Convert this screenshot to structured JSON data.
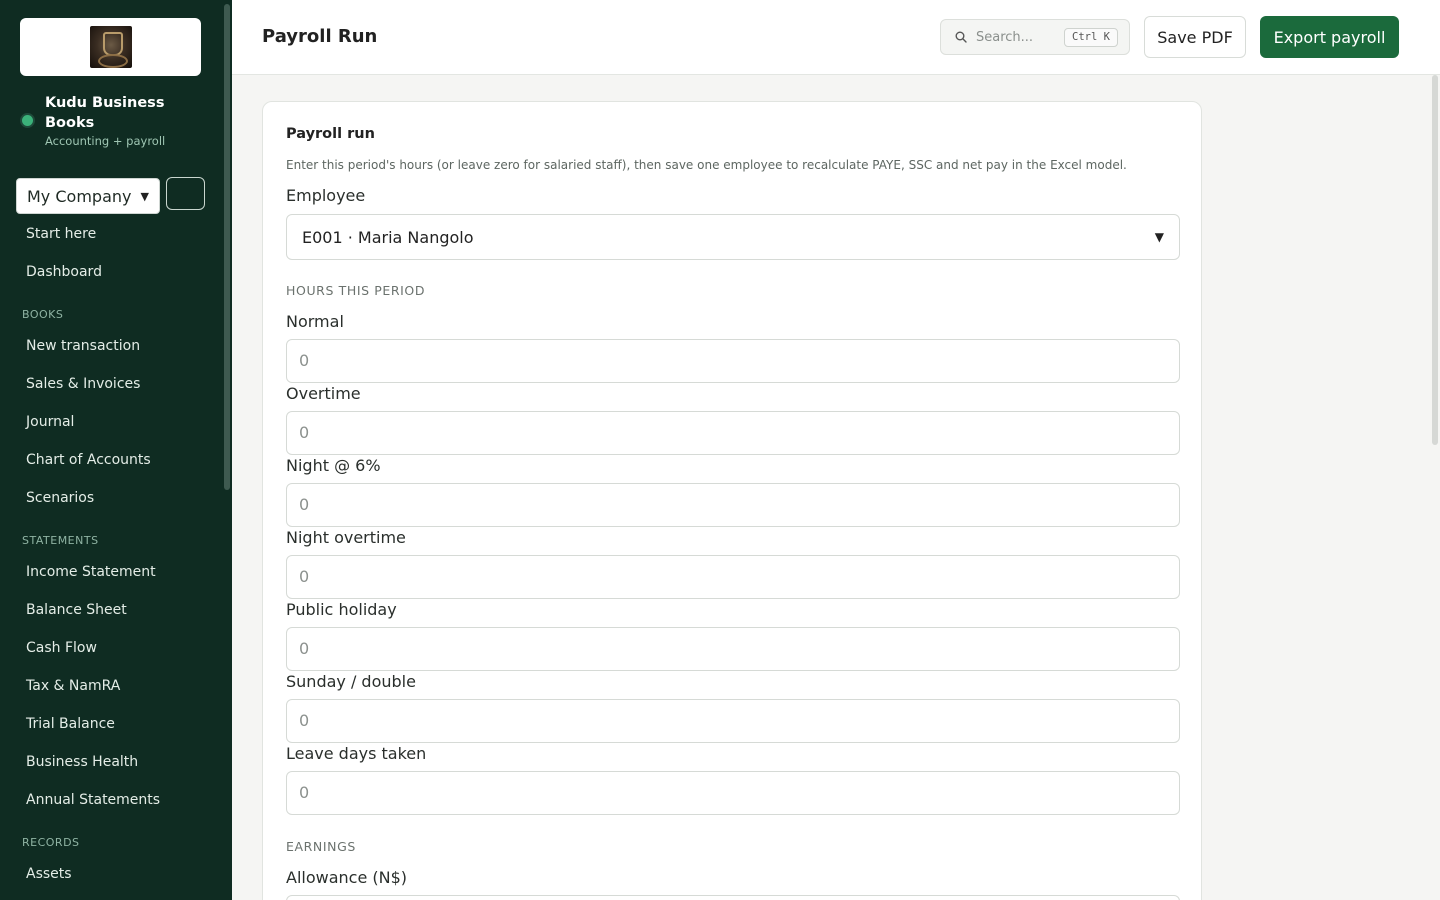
{
  "sidebar": {
    "brand_name": "Kudu Business Books",
    "brand_subtitle": "Accounting + payroll",
    "company_select": "My Company",
    "top_items": [
      "Start here",
      "Dashboard"
    ],
    "sections": [
      {
        "title": "BOOKS",
        "items": [
          "New transaction",
          "Sales & Invoices",
          "Journal",
          "Chart of Accounts",
          "Scenarios"
        ]
      },
      {
        "title": "STATEMENTS",
        "items": [
          "Income Statement",
          "Balance Sheet",
          "Cash Flow",
          "Tax & NamRA",
          "Trial Balance",
          "Business Health",
          "Annual Statements"
        ]
      },
      {
        "title": "RECORDS",
        "items": [
          "Assets"
        ]
      }
    ]
  },
  "header": {
    "title": "Payroll Run",
    "search_placeholder": "Search...",
    "search_shortcut": "Ctrl K",
    "save_pdf": "Save PDF",
    "export": "Export payroll"
  },
  "card": {
    "title": "Payroll run",
    "description": "Enter this period's hours (or leave zero for salaried staff), then save one employee to recalculate PAYE, SSC and net pay in the Excel model.",
    "employee_label": "Employee",
    "employee_value": "E001 · Maria Nangolo",
    "hours_section": "HOURS THIS PERIOD",
    "hours_fields": [
      {
        "label": "Normal",
        "value": "0"
      },
      {
        "label": "Overtime",
        "value": "0"
      },
      {
        "label": "Night @ 6%",
        "value": "0"
      },
      {
        "label": "Night overtime",
        "value": "0"
      },
      {
        "label": "Public holiday",
        "value": "0"
      },
      {
        "label": "Sunday / double",
        "value": "0"
      },
      {
        "label": "Leave days taken",
        "value": "0"
      }
    ],
    "earnings_section": "EARNINGS",
    "allowance_label": "Allowance (N$)"
  },
  "colors": {
    "sidebar_bg": "#0f2c22",
    "accent": "#1b6a3c",
    "status_dot": "#3bb27a"
  }
}
